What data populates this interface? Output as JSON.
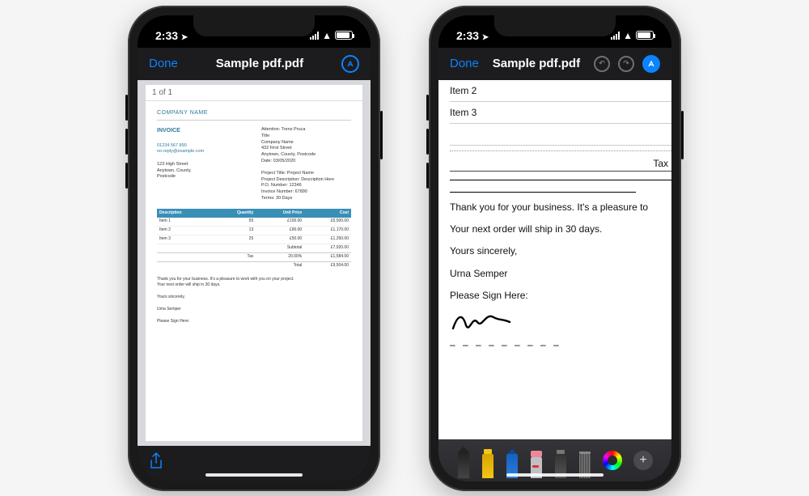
{
  "status": {
    "time": "2:33"
  },
  "left": {
    "nav": {
      "done": "Done",
      "title": "Sample pdf.pdf"
    },
    "pager": "1 of 1",
    "company": "COMPANY NAME",
    "invoice_label": "INVOICE",
    "phone": "01234 567 890",
    "email": "no-reply@example.com",
    "addr1": "123 High Street",
    "addr2": "Anytown, County,",
    "addr3": "Postcode",
    "attn": "Attention: Trenz Pruca",
    "to_title": "Title",
    "to_company": "Company Name",
    "to_addr1": "432 First Street",
    "to_addr2": "Anytown, County, Postcode",
    "date": "Date: 03/05/2020",
    "proj_title": "Project Title: Project Name",
    "proj_desc": "Project Description: Description Here",
    "po": "P.O. Number: 12346",
    "invno": "Invoice Number: 67890",
    "terms": "Terms: 30 Days",
    "th_desc": "Description",
    "th_qty": "Quantity",
    "th_up": "Unit Price",
    "th_cost": "Cost",
    "rows": [
      {
        "d": "Item 1",
        "q": "55",
        "u": "£100.00",
        "c": "£5,500.00"
      },
      {
        "d": "Item 2",
        "q": "13",
        "u": "£90.00",
        "c": "£1,170.00"
      },
      {
        "d": "Item 3",
        "q": "25",
        "u": "£50.00",
        "c": "£1,250.00"
      }
    ],
    "subtotal_l": "Subtotal",
    "subtotal_v": "£7,920.00",
    "tax_l": "Tax",
    "tax_r": "20.00%",
    "tax_v": "£1,584.00",
    "total_l": "Total",
    "total_v": "£9,504.00",
    "thanks": "Thank you for your business. It's a pleasure to work with you on your project.",
    "ship": "Your next order will ship in 30 days.",
    "yours": "Yours sincerely,",
    "signer": "Urna Semper",
    "signhere": "Please Sign Here:"
  },
  "right": {
    "nav": {
      "done": "Done",
      "title": "Sample pdf.pdf"
    },
    "item2": "Item 2",
    "item3": "Item 3",
    "tax": "Tax",
    "msg1": "Thank you for your business. It's a pleasure to",
    "msg2": "Your next order will ship in 30 days.",
    "yours": "Yours sincerely,",
    "signer": "Urna Semper",
    "signhere": "Please Sign Here:",
    "dashes": "– – – – – – – – –"
  }
}
